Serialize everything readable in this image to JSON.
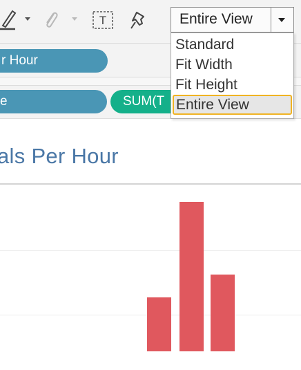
{
  "toolbar": {
    "icons": [
      "highlighter-icon",
      "paperclip-icon",
      "text-box-icon",
      "pin-icon"
    ],
    "text_box_glyph": "T",
    "view_select": {
      "value": "Entire View",
      "options": [
        "Standard",
        "Fit Width",
        "Fit Height",
        "Entire View"
      ]
    }
  },
  "shelves": {
    "columns_pill": "r Hour",
    "rows_pill_1": "e",
    "rows_pill_2": "SUM(T"
  },
  "view": {
    "title": "als Per Hour"
  },
  "chart_data": {
    "type": "bar",
    "series": [
      {
        "values": [
          78,
          216,
          111
        ]
      }
    ],
    "colors": {
      "bar": "#e0585e"
    }
  }
}
